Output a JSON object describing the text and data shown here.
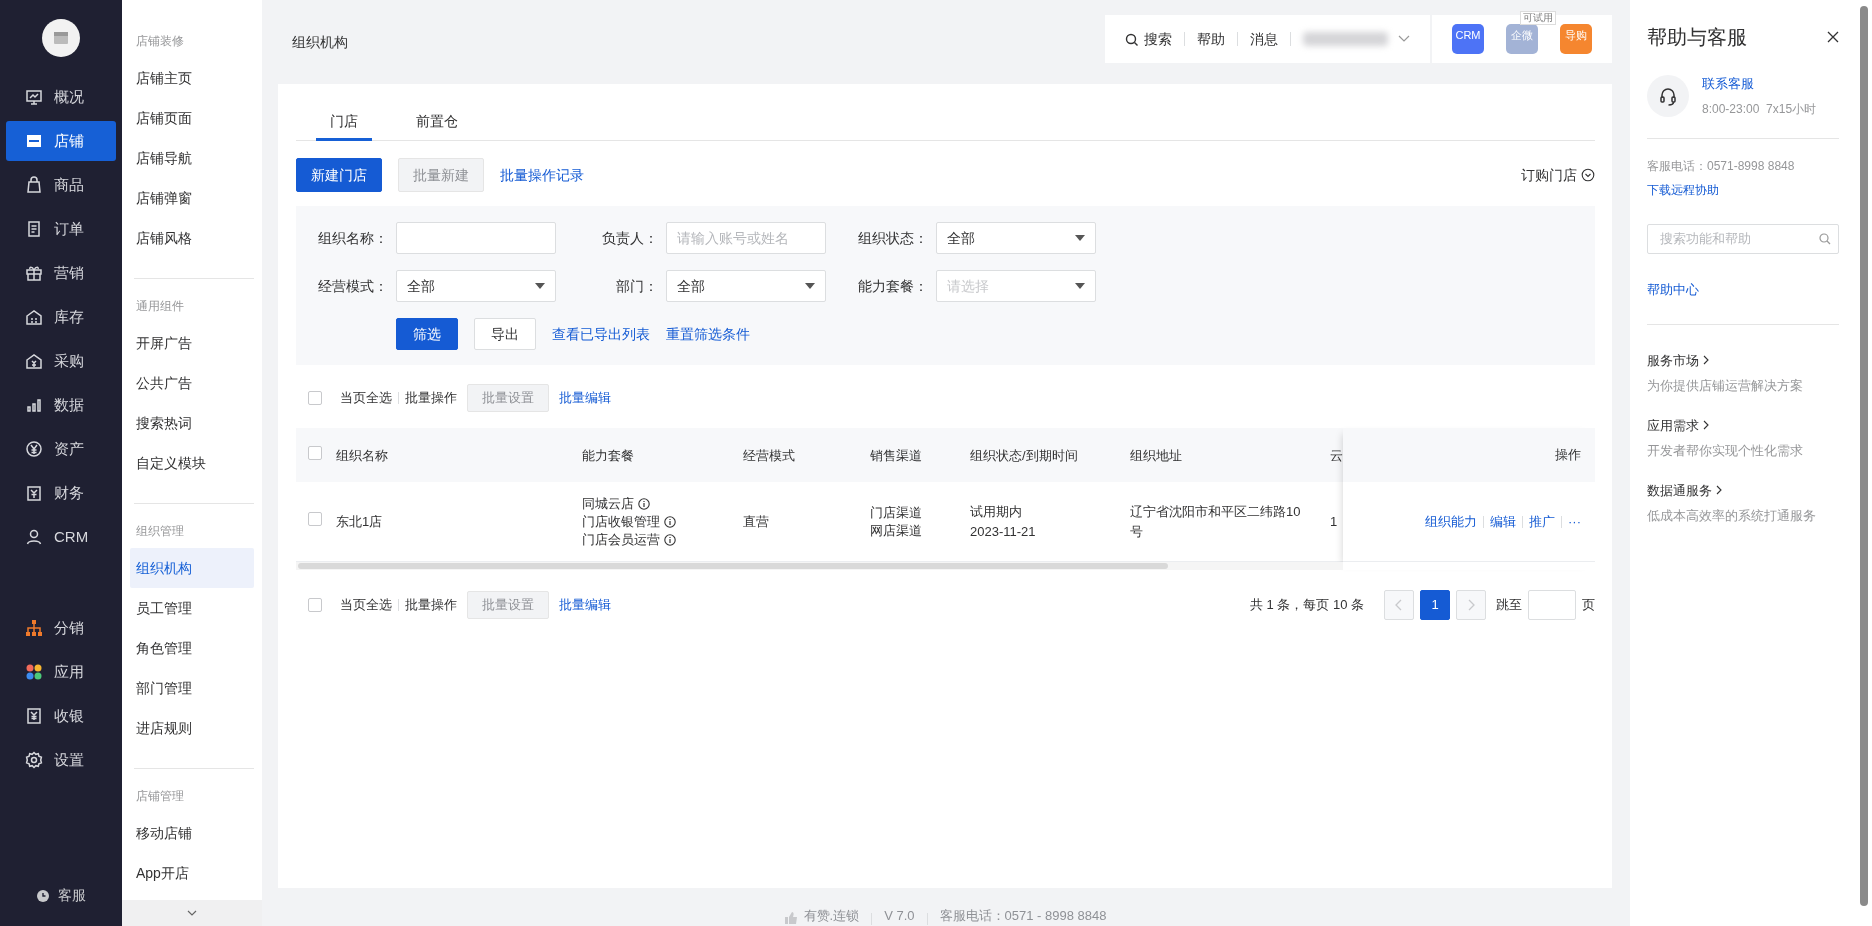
{
  "main_nav": {
    "top_items": [
      {
        "label": "概况",
        "selected": false
      },
      {
        "label": "店铺",
        "selected": true
      },
      {
        "label": "商品",
        "selected": false
      },
      {
        "label": "订单",
        "selected": false
      },
      {
        "label": "营销",
        "selected": false
      },
      {
        "label": "库存",
        "selected": false
      },
      {
        "label": "采购",
        "selected": false
      },
      {
        "label": "数据",
        "selected": false
      },
      {
        "label": "资产",
        "selected": false
      },
      {
        "label": "财务",
        "selected": false
      },
      {
        "label": "CRM",
        "selected": false
      }
    ],
    "bottom_items": [
      {
        "label": "分销",
        "selected": false
      },
      {
        "label": "应用",
        "selected": false
      },
      {
        "label": "收银",
        "selected": false
      },
      {
        "label": "设置",
        "selected": false
      }
    ],
    "service": "客服"
  },
  "sub_nav": {
    "groups": [
      {
        "title": "店铺装修",
        "items": [
          {
            "label": "店铺主页",
            "selected": false
          },
          {
            "label": "店铺页面",
            "selected": false
          },
          {
            "label": "店铺导航",
            "selected": false
          },
          {
            "label": "店铺弹窗",
            "selected": false
          },
          {
            "label": "店铺风格",
            "selected": false
          }
        ]
      },
      {
        "title": "通用组件",
        "items": [
          {
            "label": "开屏广告",
            "selected": false
          },
          {
            "label": "公共广告",
            "selected": false
          },
          {
            "label": "搜索热词",
            "selected": false
          },
          {
            "label": "自定义模块",
            "selected": false
          }
        ]
      },
      {
        "title": "组织管理",
        "items": [
          {
            "label": "组织机构",
            "selected": true
          },
          {
            "label": "员工管理",
            "selected": false
          },
          {
            "label": "角色管理",
            "selected": false
          },
          {
            "label": "部门管理",
            "selected": false
          },
          {
            "label": "进店规则",
            "selected": false
          }
        ]
      },
      {
        "title": "店铺管理",
        "items": [
          {
            "label": "移动店铺",
            "selected": false
          },
          {
            "label": "App开店",
            "selected": false
          }
        ]
      }
    ]
  },
  "page": {
    "title": "组织机构"
  },
  "top_bar": {
    "search": "搜索",
    "help": "帮助",
    "messages": "消息",
    "apps": [
      {
        "label": "CRM",
        "color": "#4d73f6"
      },
      {
        "label": "企微",
        "color": "#a3b3d6",
        "badge": "可试用"
      },
      {
        "label": "导购",
        "color": "#f5862f"
      }
    ]
  },
  "tabs": [
    {
      "label": "门店",
      "selected": true
    },
    {
      "label": "前置仓",
      "selected": false
    }
  ],
  "actions": {
    "primary": "新建门店",
    "batch_create": {
      "label": "批量新建",
      "disabled": true
    },
    "log_link": "批量操作记录",
    "subscribe": "订购门店"
  },
  "filters": [
    {
      "kind": "text",
      "label": "组织名称："
    },
    {
      "kind": "text",
      "label": "负责人：",
      "placeholder": "请输入账号或姓名"
    },
    {
      "kind": "select",
      "label": "组织状态：",
      "value": "全部"
    },
    {
      "kind": "select",
      "label": "经营模式：",
      "value": "全部"
    },
    {
      "kind": "select",
      "label": "部门：",
      "value": "全部"
    },
    {
      "kind": "select",
      "label": "能力套餐：",
      "placeholder": "请选择"
    }
  ],
  "filter_actions": {
    "filter": "筛选",
    "export": "导出",
    "links": [
      "查看已导出列表",
      "重置筛选条件"
    ]
  },
  "top_batch_bar": {
    "select_all": "当页全选",
    "checked": false,
    "batch_ops": "批量操作",
    "batch_set": {
      "label": "批量设置",
      "disabled": true
    },
    "batch_edit": "批量编辑"
  },
  "table": {
    "columns": [
      "组织名称",
      "能力套餐",
      "经营模式",
      "销售渠道",
      "组织状态/到期时间",
      "组织地址",
      "云",
      "操作"
    ],
    "header_checked": false,
    "rows": [
      {
        "checked": false,
        "name": "东北1店",
        "packages": [
          "同城云店",
          "门店收银管理",
          "门店会员运营"
        ],
        "mode": "直营",
        "channels": [
          "门店渠道",
          "网店渠道"
        ],
        "status": "试用期内",
        "expiry": "2023-11-21",
        "address": "辽宁省沈阳市和平区二纬路10号",
        "column_7": "1",
        "actions": [
          "组织能力",
          "编辑",
          "推广",
          "···"
        ]
      }
    ]
  },
  "bottom_batch_bar": {
    "select_all": "当页全选",
    "checked": false,
    "batch_ops": "批量操作",
    "batch_set": {
      "label": "批量设置",
      "disabled": true
    },
    "batch_edit": "批量编辑"
  },
  "pagination": {
    "summary": "共 1 条，每页 10 条",
    "prev_disabled": true,
    "pages": [
      {
        "label": "1",
        "selected": true
      }
    ],
    "next_disabled": true,
    "jump_label": "跳至",
    "page_unit": "页"
  },
  "footer": {
    "brand": "有赞.连锁",
    "version": "V 7.0",
    "phone": "客服电话：0571 - 8998 8848"
  },
  "help_panel": {
    "title": "帮助与客服",
    "contact_link": "联系客服",
    "hours": "8:00-23:00  7x15小时",
    "phone": "客服电话：0571-8998 8848",
    "remote_link": "下载远程协助",
    "search_placeholder": "搜索功能和帮助",
    "help_center": "帮助中心",
    "services": [
      {
        "title": "服务市场",
        "desc": "为你提供店铺运营解决方案"
      },
      {
        "title": "应用需求",
        "desc": "开发者帮你实现个性化需求"
      },
      {
        "title": "数据通服务",
        "desc": "低成本高效率的系统打通服务"
      }
    ]
  }
}
